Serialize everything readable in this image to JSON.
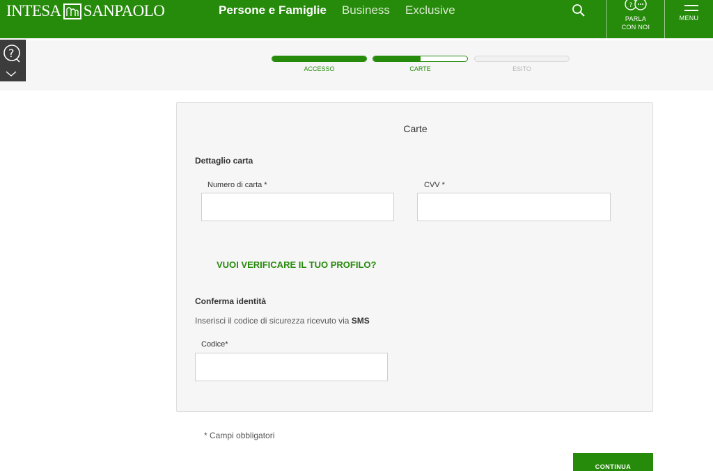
{
  "header": {
    "logo_left": "INTESA",
    "logo_right": "SANPAOLO",
    "nav": [
      {
        "label": "Persone e Famiglie",
        "active": true
      },
      {
        "label": "Business",
        "active": false
      },
      {
        "label": "Exclusive",
        "active": false
      }
    ],
    "talk_label_1": "PARLA",
    "talk_label_2": "CON NOI",
    "menu_label": "MENU",
    "brand_color": "#268a0b"
  },
  "progress": {
    "steps": [
      {
        "label": "ACCESSO",
        "state": "done",
        "fill": 1.0
      },
      {
        "label": "CARTE",
        "state": "current",
        "fill": 0.5
      },
      {
        "label": "ESITO",
        "state": "todo",
        "fill": 0.0
      }
    ]
  },
  "card": {
    "title": "Carte",
    "detail_heading": "Dettaglio carta",
    "card_number_label": "Numero di carta *",
    "card_number_value": "",
    "cvv_label": "CVV *",
    "cvv_value": "",
    "verify_link": "VUOI VERIFICARE IL TUO PROFILO?",
    "identity_heading": "Conferma identità",
    "sms_text_prefix": "Inserisci il codice di sicurezza ricevuto via ",
    "sms_text_bold": "SMS",
    "code_label": "Codice*",
    "code_value": ""
  },
  "footer": {
    "required_note": "* Campi obbligatori",
    "continue_label": "CONTINUA"
  }
}
